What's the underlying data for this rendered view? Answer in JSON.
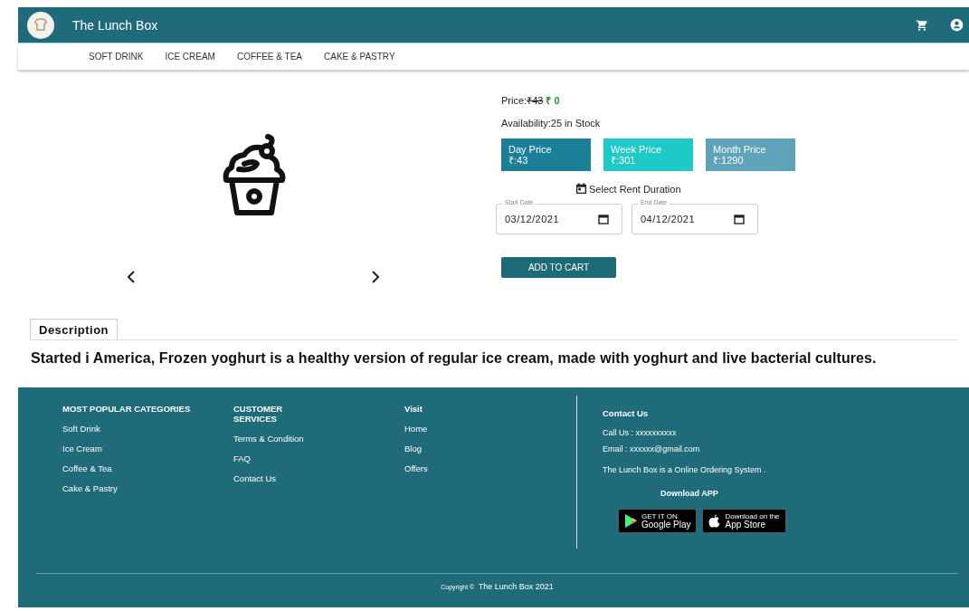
{
  "header": {
    "title": "The Lunch Box"
  },
  "nav": [
    {
      "label": "SOFT DRINK"
    },
    {
      "label": "ICE CREAM"
    },
    {
      "label": "COFFEE & TEA"
    },
    {
      "label": "CAKE & PASTRY"
    }
  ],
  "product": {
    "price_label": "Price:",
    "old_price": "₹43",
    "new_price": "₹ 0",
    "availability": "Availability:25 in Stock",
    "tiers": [
      {
        "name": "Day Price",
        "price": "₹:43",
        "color": "#1b7f98"
      },
      {
        "name": "Week Price",
        "price": "₹:301",
        "color": "#1ecac6"
      },
      {
        "name": "Month Price",
        "price": "₹:1290",
        "color": "#5ea3b8"
      }
    ],
    "rent_label": "Select Rent Duration",
    "dates": [
      {
        "label": "Start Date",
        "value": "03/12/2021"
      },
      {
        "label": "End Date",
        "value": "04/12/2021"
      }
    ],
    "cart_button": "ADD TO CART"
  },
  "tabs": [
    {
      "label": "Description",
      "selected": true
    }
  ],
  "description": "Started i America, Frozen yoghurt is a healthy version of regular ice cream, made with yoghurt and live bacterial cultures.",
  "footer": {
    "columns": [
      {
        "heading": "MOST POPULAR CATEGORIES",
        "links": [
          "Soft Drink",
          "Ice Cream",
          "Coffee & Tea",
          "Cake & Pastry"
        ]
      },
      {
        "heading": "CUSTOMER SERVICES",
        "links": [
          "Terms & Condition",
          "FAQ",
          "Contact Us"
        ]
      },
      {
        "heading": "Visit",
        "links": [
          "Home",
          "Blog",
          "Offers"
        ]
      }
    ],
    "contact": {
      "heading": "Contact Us",
      "lines": [
        "Call Us : xxxxxxxxxx",
        "Email : xxxxxx@gmail.com"
      ],
      "about": "The Lunch Box is a Online Ordering System .",
      "download": "Download APP",
      "stores": [
        {
          "kind": "play",
          "small": "GET IT ON",
          "big": "Google Play"
        },
        {
          "kind": "apple",
          "small": "Download on the",
          "big": "App Store"
        }
      ]
    },
    "copyright": {
      "prefix": "Copyright ©",
      "name": "The Lunch Box 2021"
    }
  }
}
